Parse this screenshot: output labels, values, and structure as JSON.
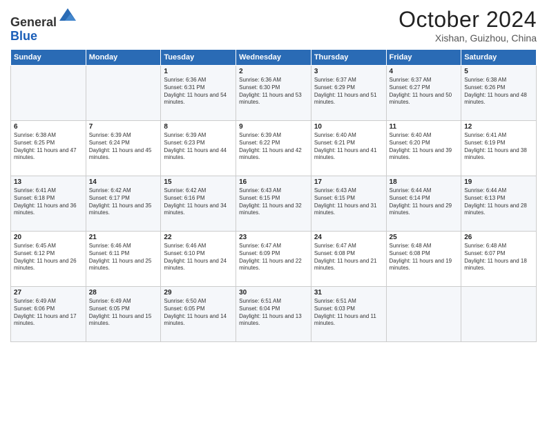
{
  "logo": {
    "line1": "General",
    "line2": "Blue"
  },
  "title": "October 2024",
  "subtitle": "Xishan, Guizhou, China",
  "days_of_week": [
    "Sunday",
    "Monday",
    "Tuesday",
    "Wednesday",
    "Thursday",
    "Friday",
    "Saturday"
  ],
  "weeks": [
    [
      {
        "day": "",
        "sunrise": "",
        "sunset": "",
        "daylight": ""
      },
      {
        "day": "",
        "sunrise": "",
        "sunset": "",
        "daylight": ""
      },
      {
        "day": "1",
        "sunrise": "Sunrise: 6:36 AM",
        "sunset": "Sunset: 6:31 PM",
        "daylight": "Daylight: 11 hours and 54 minutes."
      },
      {
        "day": "2",
        "sunrise": "Sunrise: 6:36 AM",
        "sunset": "Sunset: 6:30 PM",
        "daylight": "Daylight: 11 hours and 53 minutes."
      },
      {
        "day": "3",
        "sunrise": "Sunrise: 6:37 AM",
        "sunset": "Sunset: 6:29 PM",
        "daylight": "Daylight: 11 hours and 51 minutes."
      },
      {
        "day": "4",
        "sunrise": "Sunrise: 6:37 AM",
        "sunset": "Sunset: 6:27 PM",
        "daylight": "Daylight: 11 hours and 50 minutes."
      },
      {
        "day": "5",
        "sunrise": "Sunrise: 6:38 AM",
        "sunset": "Sunset: 6:26 PM",
        "daylight": "Daylight: 11 hours and 48 minutes."
      }
    ],
    [
      {
        "day": "6",
        "sunrise": "Sunrise: 6:38 AM",
        "sunset": "Sunset: 6:25 PM",
        "daylight": "Daylight: 11 hours and 47 minutes."
      },
      {
        "day": "7",
        "sunrise": "Sunrise: 6:39 AM",
        "sunset": "Sunset: 6:24 PM",
        "daylight": "Daylight: 11 hours and 45 minutes."
      },
      {
        "day": "8",
        "sunrise": "Sunrise: 6:39 AM",
        "sunset": "Sunset: 6:23 PM",
        "daylight": "Daylight: 11 hours and 44 minutes."
      },
      {
        "day": "9",
        "sunrise": "Sunrise: 6:39 AM",
        "sunset": "Sunset: 6:22 PM",
        "daylight": "Daylight: 11 hours and 42 minutes."
      },
      {
        "day": "10",
        "sunrise": "Sunrise: 6:40 AM",
        "sunset": "Sunset: 6:21 PM",
        "daylight": "Daylight: 11 hours and 41 minutes."
      },
      {
        "day": "11",
        "sunrise": "Sunrise: 6:40 AM",
        "sunset": "Sunset: 6:20 PM",
        "daylight": "Daylight: 11 hours and 39 minutes."
      },
      {
        "day": "12",
        "sunrise": "Sunrise: 6:41 AM",
        "sunset": "Sunset: 6:19 PM",
        "daylight": "Daylight: 11 hours and 38 minutes."
      }
    ],
    [
      {
        "day": "13",
        "sunrise": "Sunrise: 6:41 AM",
        "sunset": "Sunset: 6:18 PM",
        "daylight": "Daylight: 11 hours and 36 minutes."
      },
      {
        "day": "14",
        "sunrise": "Sunrise: 6:42 AM",
        "sunset": "Sunset: 6:17 PM",
        "daylight": "Daylight: 11 hours and 35 minutes."
      },
      {
        "day": "15",
        "sunrise": "Sunrise: 6:42 AM",
        "sunset": "Sunset: 6:16 PM",
        "daylight": "Daylight: 11 hours and 34 minutes."
      },
      {
        "day": "16",
        "sunrise": "Sunrise: 6:43 AM",
        "sunset": "Sunset: 6:15 PM",
        "daylight": "Daylight: 11 hours and 32 minutes."
      },
      {
        "day": "17",
        "sunrise": "Sunrise: 6:43 AM",
        "sunset": "Sunset: 6:15 PM",
        "daylight": "Daylight: 11 hours and 31 minutes."
      },
      {
        "day": "18",
        "sunrise": "Sunrise: 6:44 AM",
        "sunset": "Sunset: 6:14 PM",
        "daylight": "Daylight: 11 hours and 29 minutes."
      },
      {
        "day": "19",
        "sunrise": "Sunrise: 6:44 AM",
        "sunset": "Sunset: 6:13 PM",
        "daylight": "Daylight: 11 hours and 28 minutes."
      }
    ],
    [
      {
        "day": "20",
        "sunrise": "Sunrise: 6:45 AM",
        "sunset": "Sunset: 6:12 PM",
        "daylight": "Daylight: 11 hours and 26 minutes."
      },
      {
        "day": "21",
        "sunrise": "Sunrise: 6:46 AM",
        "sunset": "Sunset: 6:11 PM",
        "daylight": "Daylight: 11 hours and 25 minutes."
      },
      {
        "day": "22",
        "sunrise": "Sunrise: 6:46 AM",
        "sunset": "Sunset: 6:10 PM",
        "daylight": "Daylight: 11 hours and 24 minutes."
      },
      {
        "day": "23",
        "sunrise": "Sunrise: 6:47 AM",
        "sunset": "Sunset: 6:09 PM",
        "daylight": "Daylight: 11 hours and 22 minutes."
      },
      {
        "day": "24",
        "sunrise": "Sunrise: 6:47 AM",
        "sunset": "Sunset: 6:08 PM",
        "daylight": "Daylight: 11 hours and 21 minutes."
      },
      {
        "day": "25",
        "sunrise": "Sunrise: 6:48 AM",
        "sunset": "Sunset: 6:08 PM",
        "daylight": "Daylight: 11 hours and 19 minutes."
      },
      {
        "day": "26",
        "sunrise": "Sunrise: 6:48 AM",
        "sunset": "Sunset: 6:07 PM",
        "daylight": "Daylight: 11 hours and 18 minutes."
      }
    ],
    [
      {
        "day": "27",
        "sunrise": "Sunrise: 6:49 AM",
        "sunset": "Sunset: 6:06 PM",
        "daylight": "Daylight: 11 hours and 17 minutes."
      },
      {
        "day": "28",
        "sunrise": "Sunrise: 6:49 AM",
        "sunset": "Sunset: 6:05 PM",
        "daylight": "Daylight: 11 hours and 15 minutes."
      },
      {
        "day": "29",
        "sunrise": "Sunrise: 6:50 AM",
        "sunset": "Sunset: 6:05 PM",
        "daylight": "Daylight: 11 hours and 14 minutes."
      },
      {
        "day": "30",
        "sunrise": "Sunrise: 6:51 AM",
        "sunset": "Sunset: 6:04 PM",
        "daylight": "Daylight: 11 hours and 13 minutes."
      },
      {
        "day": "31",
        "sunrise": "Sunrise: 6:51 AM",
        "sunset": "Sunset: 6:03 PM",
        "daylight": "Daylight: 11 hours and 11 minutes."
      },
      {
        "day": "",
        "sunrise": "",
        "sunset": "",
        "daylight": ""
      },
      {
        "day": "",
        "sunrise": "",
        "sunset": "",
        "daylight": ""
      }
    ]
  ]
}
